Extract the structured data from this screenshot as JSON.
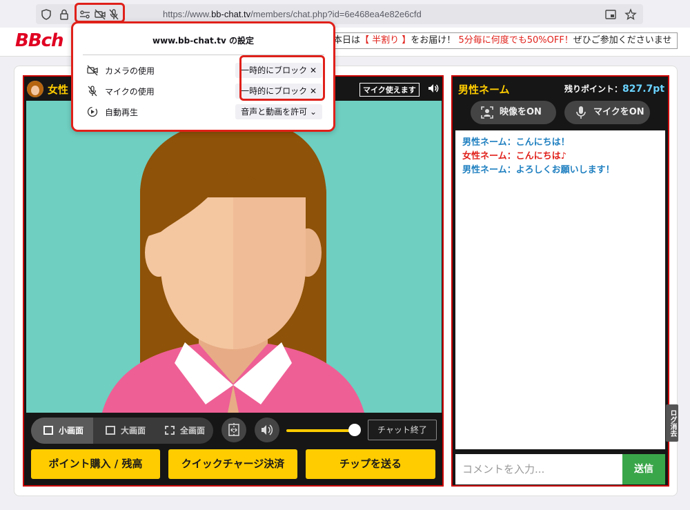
{
  "browser": {
    "url_prefix": "https://www.",
    "url_domain": "bb-chat.tv",
    "url_path": "/members/chat.php?id=6e468ea4e82e6cfd"
  },
  "site": {
    "logo": "BBch",
    "marquee_before": "本日は",
    "marquee_highlight": "【 半割り 】",
    "marquee_mid": "をお届け！",
    "marquee_red": "5分毎に何度でも50%OFF！",
    "marquee_after": "ぜひご参加くださいませ"
  },
  "popup": {
    "title": "www.bb-chat.tv の設定",
    "rows": [
      {
        "label": "カメラの使用",
        "value": "一時的にブロック ✕"
      },
      {
        "label": "マイクの使用",
        "value": "一時的にブロック ✕"
      },
      {
        "label": "自動再生",
        "value": "音声と動画を許可 ⌄"
      }
    ]
  },
  "video": {
    "performer_name": "女性",
    "mic_badge": "マイク使えます",
    "size_small": "小画面",
    "size_large": "大画面",
    "size_full": "全画面",
    "end_chat": "チャット終了",
    "volume_level": 1.0,
    "buy_points": "ポイント購入 / 残高",
    "quick_charge": "クイックチャージ決済",
    "send_tip": "チップを送る"
  },
  "chat": {
    "user_name": "男性ネーム",
    "points_label": "残りポイント：",
    "points_value": "827.7pt",
    "video_on": "映像をON",
    "mic_on": "マイクをON",
    "messages": [
      {
        "sender": "男性ネーム：",
        "text": "こんにちは！",
        "gender": "m"
      },
      {
        "sender": "女性ネーム：",
        "text": "こんにちは♪",
        "gender": "f"
      },
      {
        "sender": "男性ネーム：",
        "text": "よろしくお願いします！",
        "gender": "m"
      }
    ],
    "comment_placeholder": "コメントを入力...",
    "send": "送信",
    "log_clear": "ログ消去"
  },
  "colors": {
    "accent_red": "#e0201a",
    "yellow": "#ffcc00",
    "video_bg": "#6fcfc1",
    "send_green": "#3aa64a",
    "male_blue": "#1e7fc0"
  }
}
